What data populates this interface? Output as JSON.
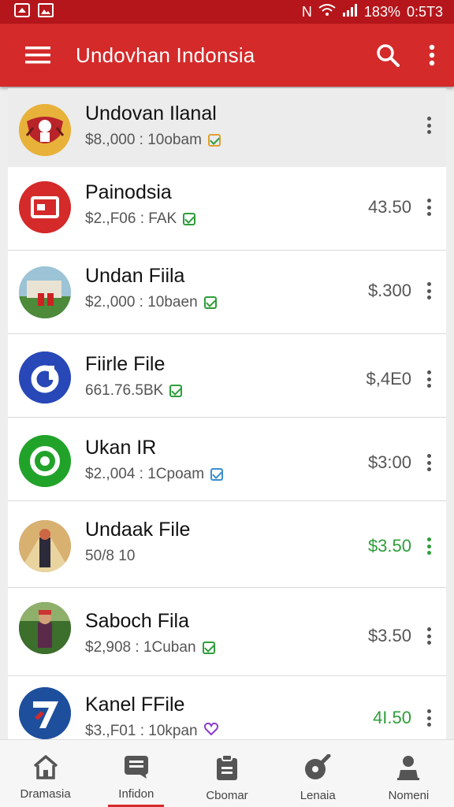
{
  "status": {
    "carrier": "N",
    "battery": "183%",
    "time": "0:5T3"
  },
  "appbar": {
    "title": "Undovhan Indonsia"
  },
  "colors": {
    "brand": "#d42a2a",
    "green": "#2e9e3a"
  },
  "items": [
    {
      "name": "Undovan Ilanal",
      "sub": "$8.,000 : 10obam",
      "price": "",
      "badge": "check-icon",
      "selected": true
    },
    {
      "name": "Painodsia",
      "sub": "$2.,F06 : FAK",
      "price": "43.50",
      "badge": "check-icon"
    },
    {
      "name": "Undan Fiila",
      "sub": "$2.,000 : 10baen",
      "price": "$.300",
      "badge": "check-icon"
    },
    {
      "name": "Fiirle File",
      "sub": "661.76.5BK",
      "price": "$,4E0",
      "badge": "check-icon"
    },
    {
      "name": "Ukan IR",
      "sub": "$2.,004 : 1Cpoam",
      "price": "$3:00",
      "badge": "check-icon"
    },
    {
      "name": "Undaak File",
      "sub": "50/8 10",
      "price": "$3.50",
      "badge": ""
    },
    {
      "name": "Saboch Fila",
      "sub": "$2,908 : 1Cuban",
      "price": "$3.50",
      "badge": "check-icon"
    },
    {
      "name": "Kanel FFile",
      "sub": "$3.,F01 : 10kpan",
      "price": "4I.50",
      "badge": "heart-icon"
    }
  ],
  "tabs": [
    {
      "label": "Dramasia",
      "icon": "home-icon"
    },
    {
      "label": "Infidon",
      "icon": "chat-icon",
      "active": true
    },
    {
      "label": "Cbomar",
      "icon": "clipboard-icon"
    },
    {
      "label": "Lenaia",
      "icon": "edit-icon"
    },
    {
      "label": "Nomeni",
      "icon": "user-icon"
    }
  ]
}
